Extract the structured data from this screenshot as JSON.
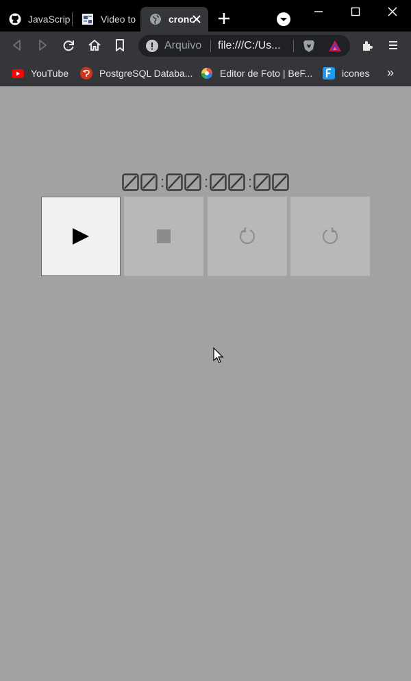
{
  "browser": {
    "tabs": [
      {
        "title": "JavaScrip",
        "icon": "github-icon"
      },
      {
        "title": "Video to",
        "icon": "video-converter-icon"
      },
      {
        "title": "crono",
        "icon": "globe-icon",
        "active": true
      }
    ],
    "address_bar": {
      "scheme_label": "Arquivo",
      "url": "file:///C:/Us..."
    },
    "bookmarks": [
      {
        "label": "YouTube",
        "icon": "youtube-icon"
      },
      {
        "label": "PostgreSQL Databa...",
        "icon": "postgresql-icon"
      },
      {
        "label": "Editor de Foto | BeF...",
        "icon": "befunky-icon"
      },
      {
        "label": "icones",
        "icon": "flaticon-icon"
      }
    ],
    "bookmarks_overflow": "»"
  },
  "stopwatch": {
    "separator": ":",
    "colors": {
      "digit_stroke": "#3a3a3a",
      "active_button": "#f1f0f2",
      "disabled_button": "#b8b7b9",
      "page_background": "#a2a1a3"
    },
    "controls": [
      {
        "name": "play",
        "icon": "play-icon",
        "enabled": true
      },
      {
        "name": "stop",
        "icon": "stop-icon",
        "enabled": false
      },
      {
        "name": "rewind",
        "icon": "rotate-left-icon",
        "enabled": false
      },
      {
        "name": "forward",
        "icon": "rotate-right-icon",
        "enabled": false
      }
    ]
  }
}
